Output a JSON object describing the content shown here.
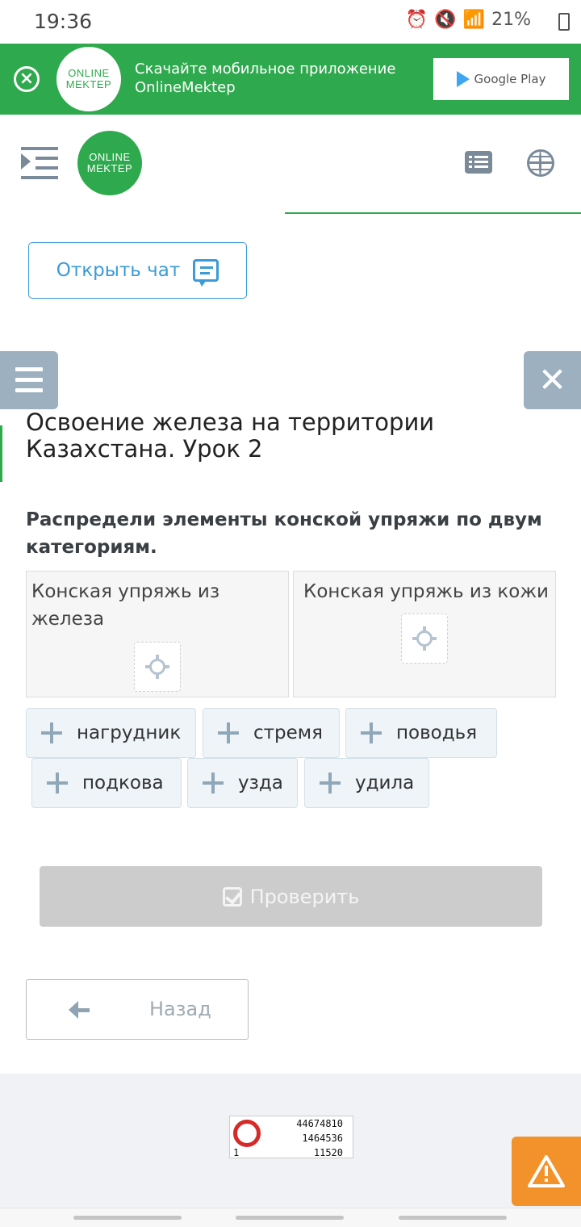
{
  "status_bar": {
    "time": "19:36",
    "battery": "21%"
  },
  "banner": {
    "logo_line1": "ONLINE",
    "logo_line2": "MEKTEP",
    "message": "Скачайте мобильное приложение OnlineMektep",
    "store_button": "Google Play"
  },
  "header": {
    "logo_line1": "ONLINE",
    "logo_line2": "MEKTEP"
  },
  "chat_button": {
    "label": "Открыть чат"
  },
  "lesson": {
    "title": "Освоение железа на территории Казахстана. Урок 2",
    "task": "Распредели элементы конской упряжи по двум категориям."
  },
  "buckets": [
    {
      "title": "Конская упряжь из железа"
    },
    {
      "title": "Конская упряжь из кожи"
    }
  ],
  "chips": [
    "нагрудник",
    "стремя",
    "поводья",
    "подкова",
    "узда",
    "удила"
  ],
  "check_button": {
    "label": "Проверить"
  },
  "back_button": {
    "label": "Назад"
  },
  "counter": {
    "line1": "44674810",
    "line2": "1464536",
    "line3_left": "1",
    "line3_right": "11520"
  },
  "colors": {
    "brand_green": "#2fa94e",
    "accent_blue": "#3a9bd8",
    "warning_orange": "#f3922b",
    "tab_gray": "#9cb0bf"
  }
}
